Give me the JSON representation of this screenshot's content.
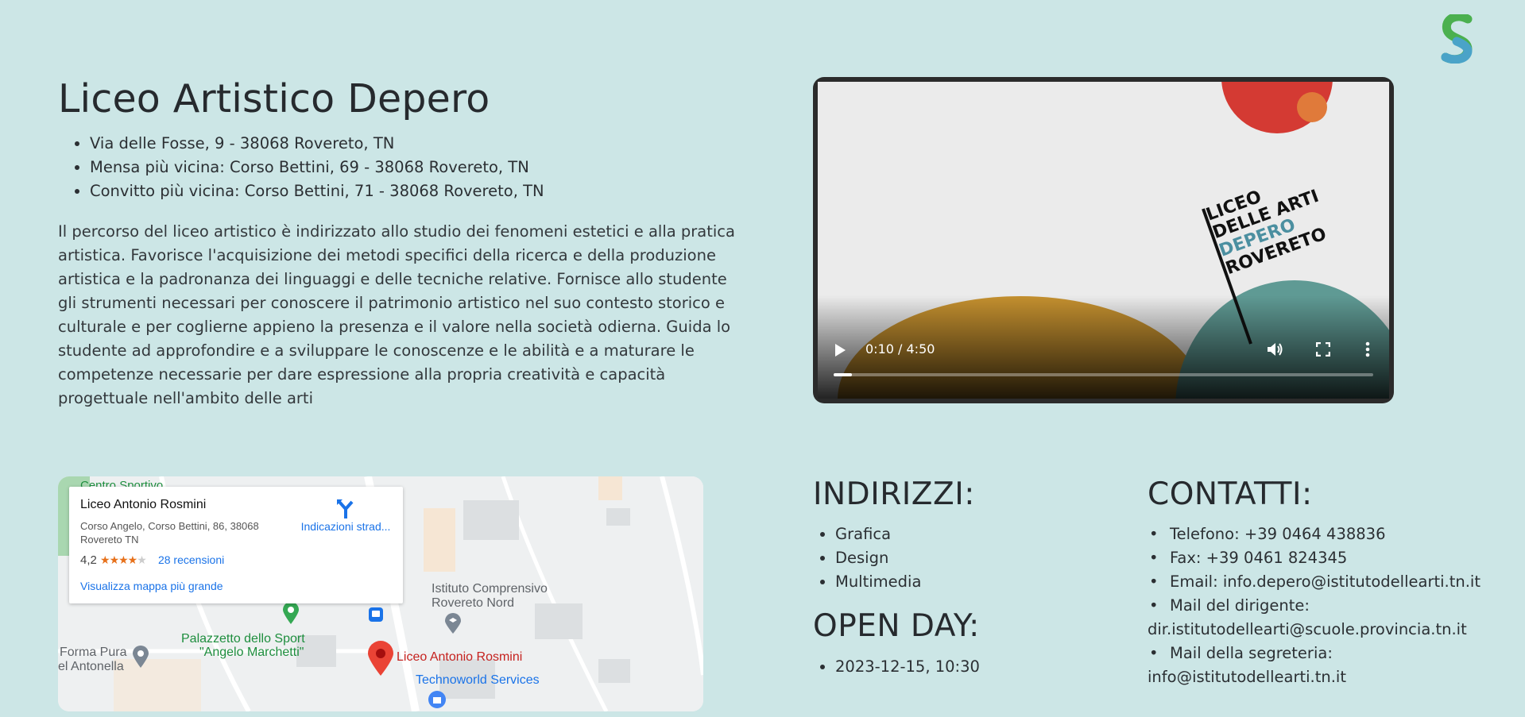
{
  "school": {
    "title": "Liceo Artistico Depero",
    "addresses": [
      "Via delle Fosse, 9 - 38068 Rovereto, TN",
      "Mensa più vicina: Corso Bettini, 69 - 38068 Rovereto, TN",
      "Convitto più vicina: Corso Bettini, 71 - 38068 Rovereto, TN"
    ],
    "description": "Il percorso del liceo artistico è indirizzato allo studio dei fenomeni estetici e alla pratica artistica. Favorisce l'acquisizione dei metodi specifici della ricerca e della produzione artistica e la padronanza dei linguaggi e delle tecniche relative. Fornisce allo studente gli strumenti necessari per conoscere il patrimonio artistico nel suo contesto storico e culturale e per coglierne appieno la presenza e il valore nella società odierna. Guida lo studente ad approfondire e a sviluppare le conoscenze e le abilità e a maturare le competenze necessarie per dare espressione alla propria creatività e capacità progettuale nell'ambito delle arti"
  },
  "video": {
    "time": "0:10 / 4:50",
    "progress_fraction": 0.034,
    "poster_lines": [
      "LICEO",
      "DELLE ARTI",
      "DEPERO",
      "ROVERETO"
    ],
    "accent_color": "#4b8fa0"
  },
  "map": {
    "card": {
      "title": "Liceo Antonio Rosmini",
      "address": "Corso Angelo, Corso Bettini, 86, 38068 Rovereto TN",
      "rating": "4,2",
      "stars": "★★★★",
      "star_empty": "★",
      "reviews": "28 recensioni",
      "directions": "Indicazioni strad...",
      "larger_map": "Visualizza mappa più grande"
    },
    "labels": {
      "centro": "Centro Sportivo",
      "istituto": "Istituto Comprensivo",
      "istituto2": "Rovereto Nord",
      "palazzetto": "Palazzetto dello Sport",
      "palazzetto2": "\"Angelo Marchetti\"",
      "forma": "Forma Pura",
      "forma2": "el Antonella",
      "marker": "Liceo Antonio Rosmini",
      "techno": "Technoworld Services"
    },
    "pin_color": "#ea4335"
  },
  "indirizzi": {
    "heading": "INDIRIZZI:",
    "items": [
      "Grafica",
      "Design",
      "Multimedia"
    ]
  },
  "openday": {
    "heading": "OPEN DAY:",
    "items": [
      "2023-12-15, 10:30"
    ]
  },
  "contatti": {
    "heading": "CONTATTI:",
    "items": [
      "Telefono: +39 0464 438836",
      "Fax: +39 0461 824345",
      "Email: info.depero@istitutodellearti.tn.it",
      "Mail del dirigente: dir.istitutodellearti@scuole.provincia.tn.it",
      "Mail della segreteria: info@istitutodellearti.tn.it"
    ]
  }
}
